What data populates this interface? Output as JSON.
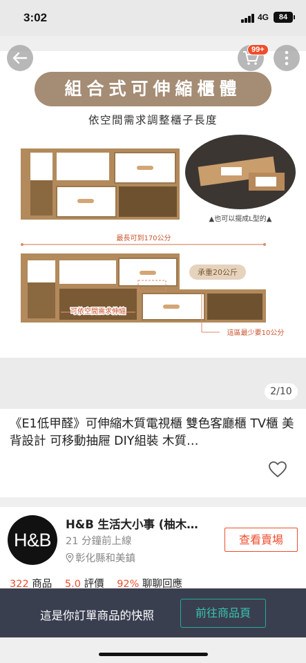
{
  "status_bar": {
    "time": "3:02",
    "network": "4G",
    "battery": "84"
  },
  "product_image": {
    "banner_title": "組合式可伸縮櫃體",
    "subtitle": "依空間需求調整櫃子長度",
    "l_shape_caption": "▲也可以擺成L型的▲",
    "max_length_label": "最長可到170公分",
    "load_label": "承重20公斤",
    "stretch_label": "可依空間需求伸縮",
    "min_length_label": "這區最少要10公分",
    "page_counter": "2/10"
  },
  "nav": {
    "cart_badge": "99+"
  },
  "product": {
    "title": "《E1低甲醛》可伸縮木質電視櫃 雙色客廳櫃 TV櫃 美背設計 可移動抽屜 DIY組裝 木質…"
  },
  "shop": {
    "avatar_text": "H&B",
    "name": "H&B 生活大小事 (柚木…",
    "online": "21 分鐘前上線",
    "location": "彰化縣和美鎮",
    "view_shop_label": "查看賣場",
    "stats": {
      "products_value": "322",
      "products_label": "商品",
      "rating_value": "5.0",
      "rating_label": "評價",
      "chat_value": "92%",
      "chat_label": "聊聊回應"
    }
  },
  "snapshot": {
    "text": "這是你訂單商品的快照",
    "button_label": "前往商品頁"
  },
  "colors": {
    "accent": "#ee4d2d",
    "teal": "#26aa99",
    "banner": "#a58c74",
    "wood": "#b38a5c"
  }
}
